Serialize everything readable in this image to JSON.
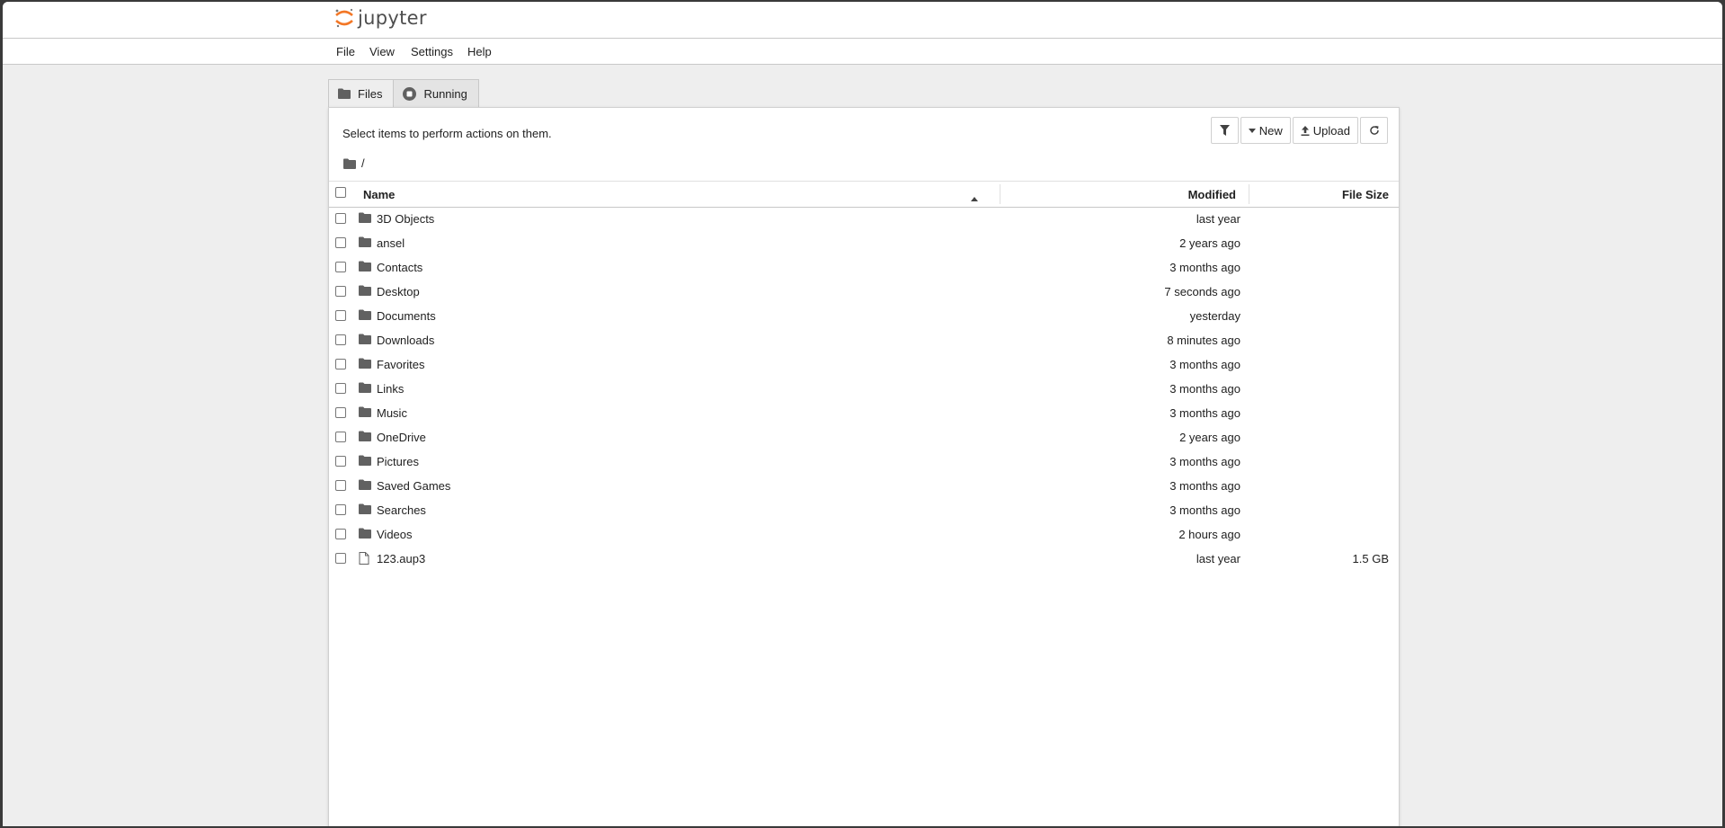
{
  "app": {
    "logo_text": "jupyter"
  },
  "menu": [
    {
      "label": "File"
    },
    {
      "label": "View"
    },
    {
      "label": "Settings"
    },
    {
      "label": "Help"
    }
  ],
  "tabs": [
    {
      "label": "Files",
      "icon": "folder-icon"
    },
    {
      "label": "Running",
      "icon": "stop-circle-icon"
    }
  ],
  "toolbar": {
    "hint": "Select items to perform actions on them.",
    "new_label": "New",
    "upload_label": "Upload"
  },
  "breadcrumb": {
    "path": "/"
  },
  "table": {
    "columns": {
      "name": "Name",
      "modified": "Modified",
      "size": "File Size"
    },
    "rows": [
      {
        "name": "3D Objects",
        "modified": "last year",
        "size": "",
        "type": "folder"
      },
      {
        "name": "ansel",
        "modified": "2 years ago",
        "size": "",
        "type": "folder"
      },
      {
        "name": "Contacts",
        "modified": "3 months ago",
        "size": "",
        "type": "folder"
      },
      {
        "name": "Desktop",
        "modified": "7 seconds ago",
        "size": "",
        "type": "folder"
      },
      {
        "name": "Documents",
        "modified": "yesterday",
        "size": "",
        "type": "folder"
      },
      {
        "name": "Downloads",
        "modified": "8 minutes ago",
        "size": "",
        "type": "folder"
      },
      {
        "name": "Favorites",
        "modified": "3 months ago",
        "size": "",
        "type": "folder"
      },
      {
        "name": "Links",
        "modified": "3 months ago",
        "size": "",
        "type": "folder"
      },
      {
        "name": "Music",
        "modified": "3 months ago",
        "size": "",
        "type": "folder"
      },
      {
        "name": "OneDrive",
        "modified": "2 years ago",
        "size": "",
        "type": "folder"
      },
      {
        "name": "Pictures",
        "modified": "3 months ago",
        "size": "",
        "type": "folder"
      },
      {
        "name": "Saved Games",
        "modified": "3 months ago",
        "size": "",
        "type": "folder"
      },
      {
        "name": "Searches",
        "modified": "3 months ago",
        "size": "",
        "type": "folder"
      },
      {
        "name": "Videos",
        "modified": "2 hours ago",
        "size": "",
        "type": "folder"
      },
      {
        "name": "123.aup3",
        "modified": "last year",
        "size": "1.5 GB",
        "type": "file"
      }
    ]
  },
  "colors": {
    "logo_orange": "#F37726",
    "icon_gray": "#616161",
    "page_bg": "#eeeeee"
  }
}
